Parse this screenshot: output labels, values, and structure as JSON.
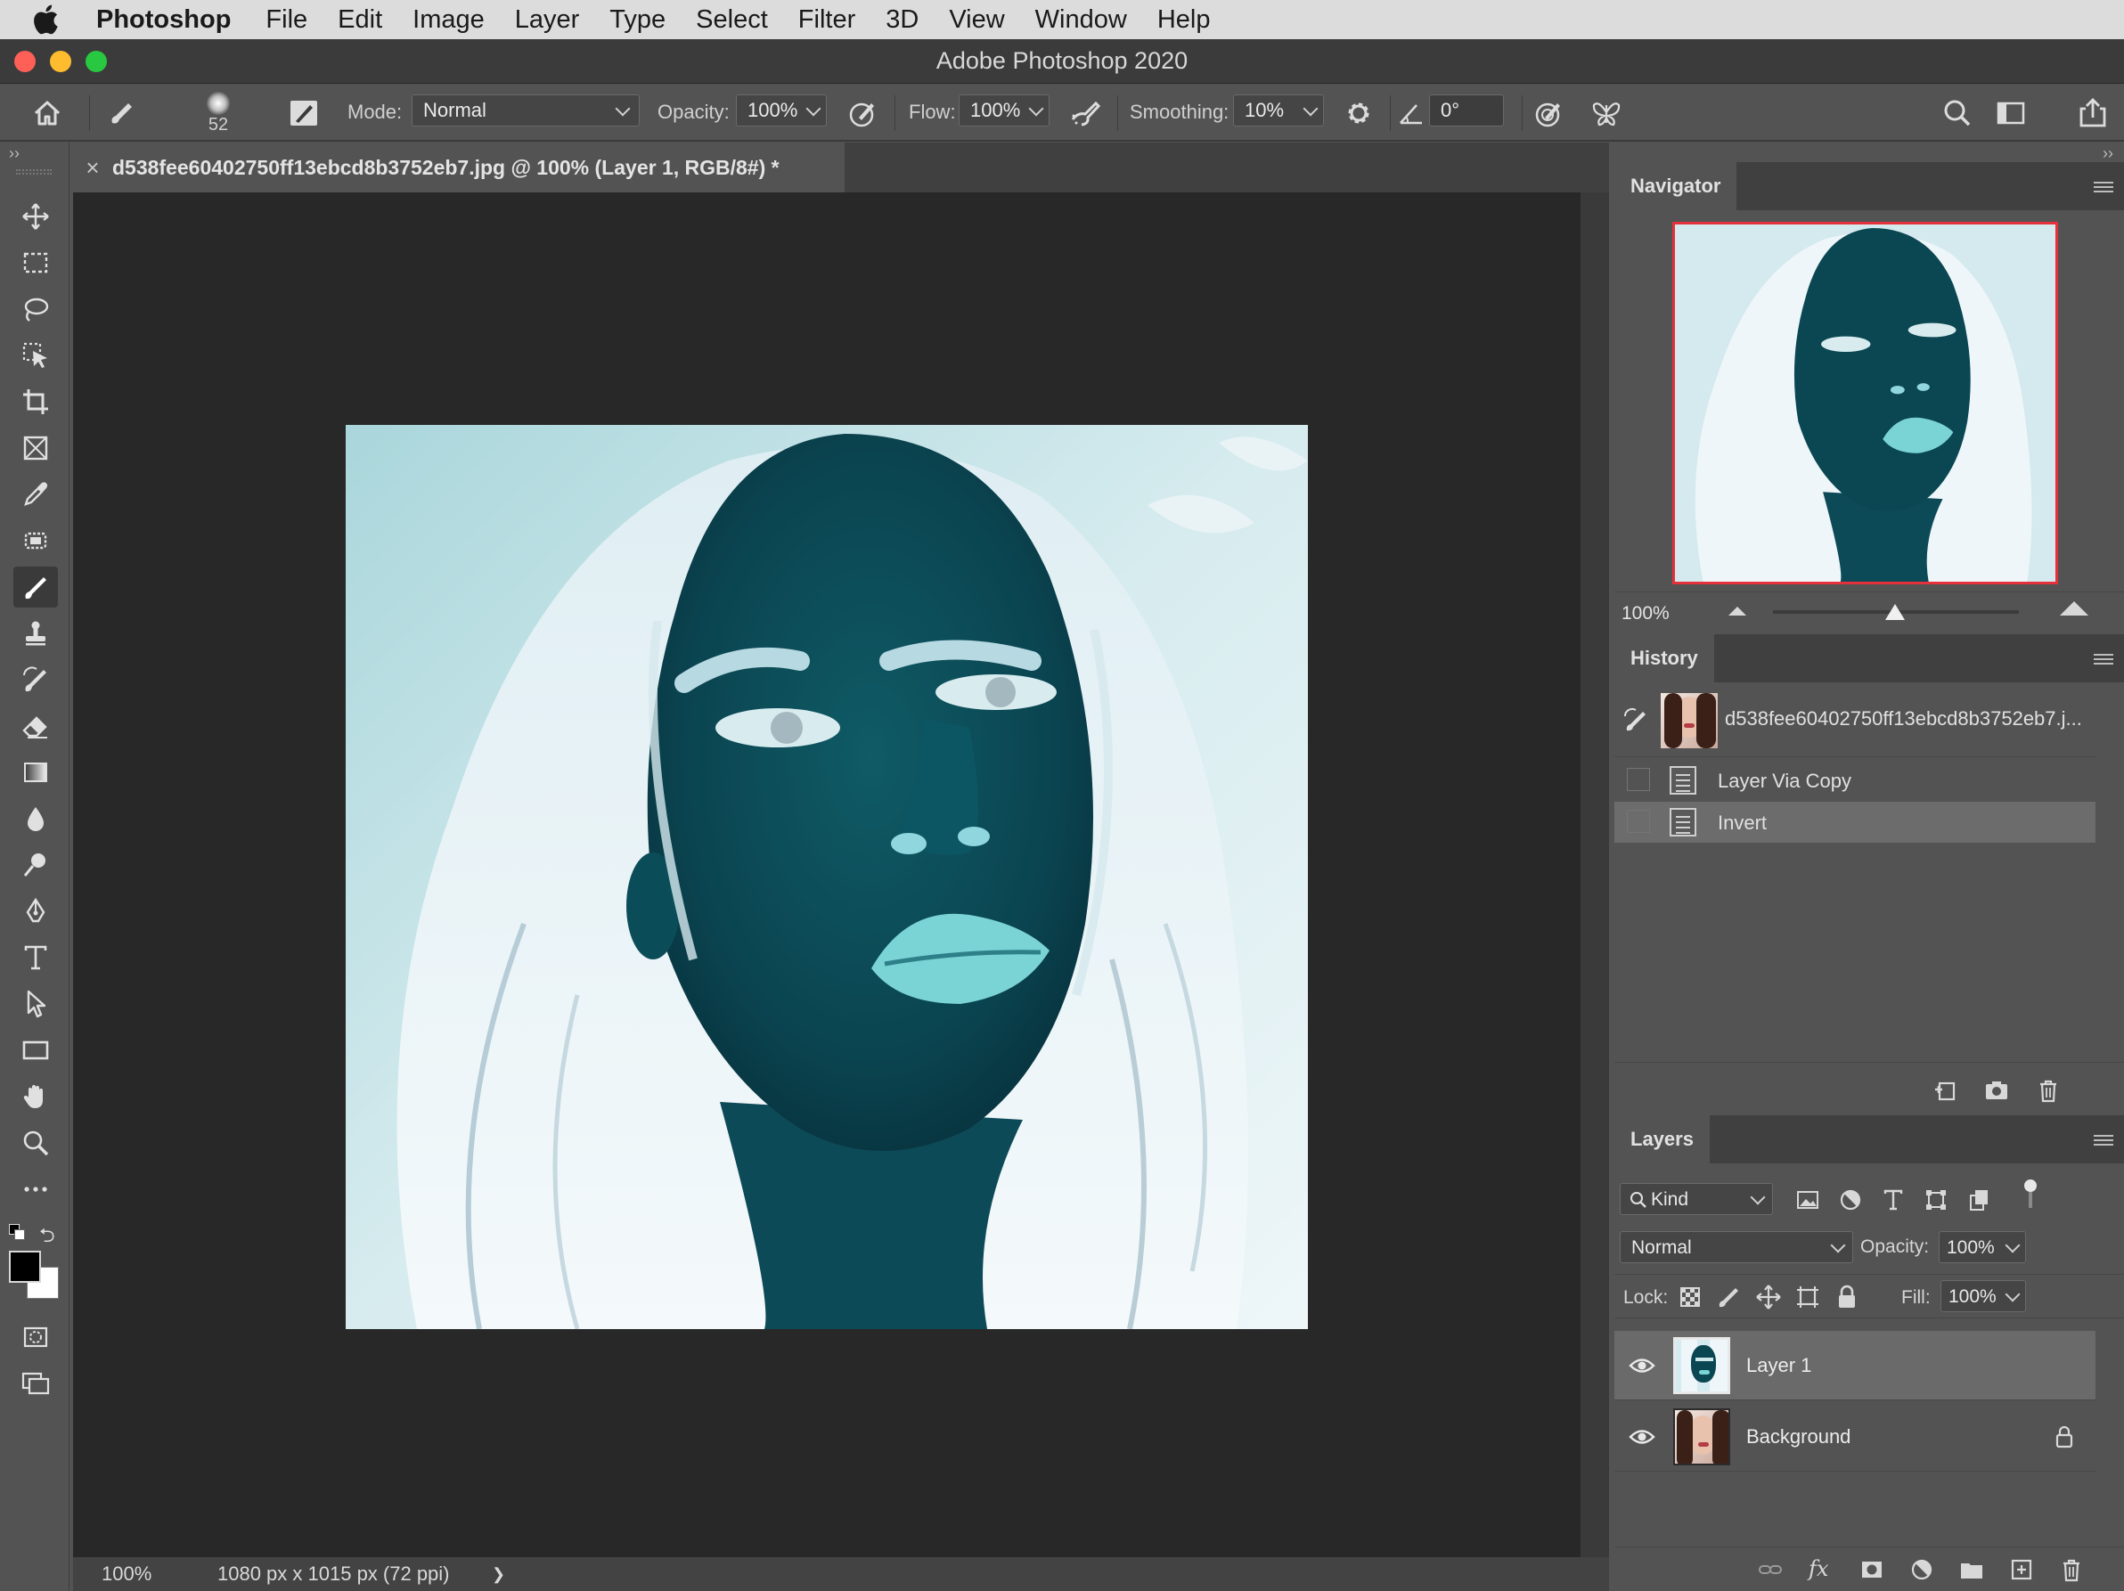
{
  "menubar": {
    "app_name": "Photoshop",
    "items": [
      "File",
      "Edit",
      "Image",
      "Layer",
      "Type",
      "Select",
      "Filter",
      "3D",
      "View",
      "Window",
      "Help"
    ]
  },
  "window": {
    "title": "Adobe Photoshop 2020"
  },
  "options": {
    "brush_size": "52",
    "mode_label": "Mode:",
    "mode_value": "Normal",
    "opacity_label": "Opacity:",
    "opacity_value": "100%",
    "flow_label": "Flow:",
    "flow_value": "100%",
    "smoothing_label": "Smoothing:",
    "smoothing_value": "10%",
    "angle_value": "0°"
  },
  "document": {
    "tab_title": "d538fee60402750ff13ebcd8b3752eb7.jpg @ 100% (Layer 1, RGB/8#) *",
    "close_glyph": "×",
    "zoom": "100%",
    "dimensions": "1080 px x 1015 px (72 ppi)",
    "status_arrow": "❯"
  },
  "navigator": {
    "title": "Navigator",
    "zoom": "100%",
    "zoom_slider_value": 0.46
  },
  "history": {
    "title": "History",
    "snapshot": "d538fee60402750ff13ebcd8b3752eb7.j...",
    "steps": [
      "Layer Via Copy",
      "Invert"
    ],
    "selected_step": "Invert"
  },
  "layers": {
    "title": "Layers",
    "filter_kind": "Kind",
    "blend_mode": "Normal",
    "opacity_label": "Opacity:",
    "opacity_value": "100%",
    "lock_label": "Lock:",
    "fill_label": "Fill:",
    "fill_value": "100%",
    "items": [
      {
        "name": "Layer 1",
        "visible": true,
        "selected": true,
        "locked": false
      },
      {
        "name": "Background",
        "visible": true,
        "selected": false,
        "locked": true
      }
    ]
  },
  "colors": {
    "foreground": "#000000",
    "background": "#ffffff",
    "navigator_frame": "#e4313b"
  },
  "icons": {
    "toolbar": [
      "move-icon",
      "marquee-icon",
      "lasso-icon",
      "object-select-icon",
      "crop-icon",
      "frame-icon",
      "eyedropper-icon",
      "spot-heal-icon",
      "brush-icon",
      "stamp-icon",
      "history-brush-icon",
      "eraser-icon",
      "gradient-icon",
      "blur-icon",
      "dodge-icon",
      "pen-icon",
      "type-icon",
      "path-select-icon",
      "rectangle-icon",
      "hand-icon",
      "zoom-icon",
      "more-icon"
    ]
  }
}
